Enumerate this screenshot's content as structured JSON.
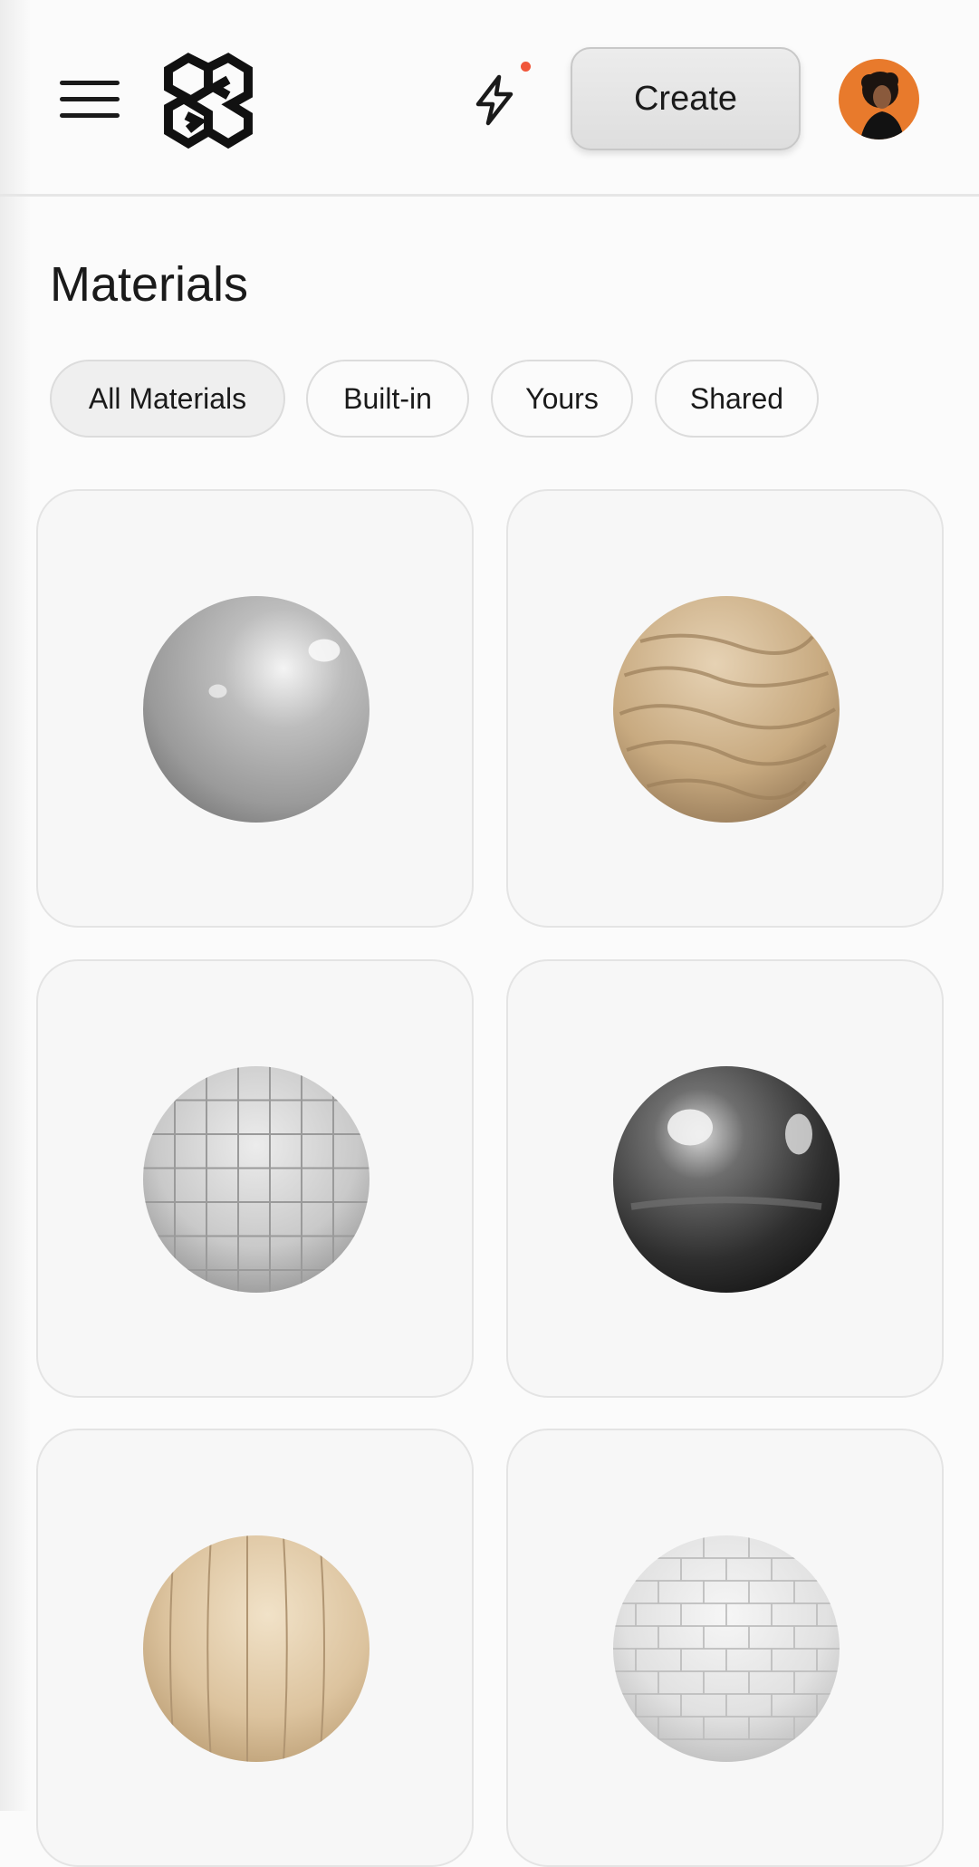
{
  "header": {
    "menu_icon": "hamburger-menu-icon",
    "logo_icon": "brand-logo-icon",
    "activity_icon": "lightning-bolt-icon",
    "create_label": "Create",
    "notification_color": "#f0563a",
    "avatar_bg": "#e87a2c"
  },
  "page": {
    "title": "Materials"
  },
  "filters": [
    {
      "label": "All Materials",
      "active": true
    },
    {
      "label": "Built-in",
      "active": false
    },
    {
      "label": "Yours",
      "active": false
    },
    {
      "label": "Shared",
      "active": false
    }
  ],
  "materials": [
    {
      "kind": "glossy-grey-plastic",
      "color": "#a9a9a9"
    },
    {
      "kind": "sand",
      "color": "#c9ad86"
    },
    {
      "kind": "white-tiles",
      "color": "#cfcfcf"
    },
    {
      "kind": "chrome-metal",
      "color": "#3a3a3a"
    },
    {
      "kind": "wood-planks",
      "color": "#dcc39e"
    },
    {
      "kind": "white-bricks",
      "color": "#e4e4e4"
    }
  ]
}
